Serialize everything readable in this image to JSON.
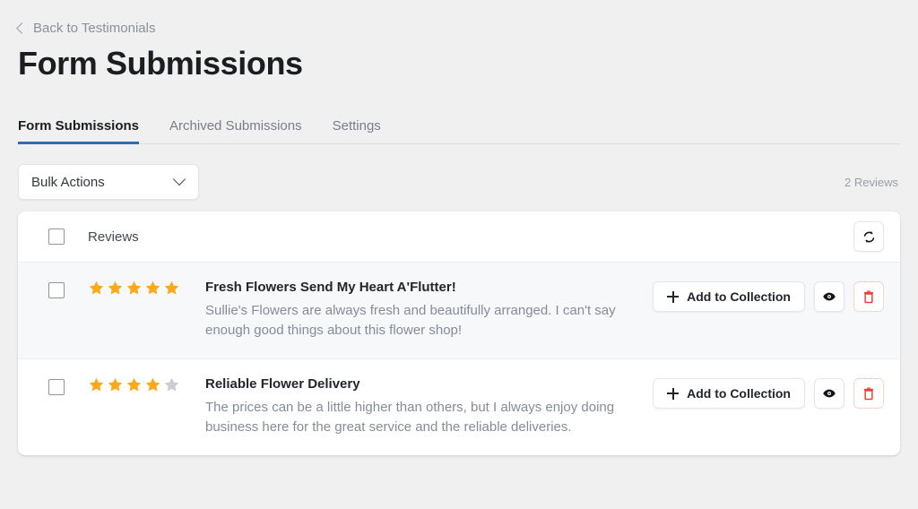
{
  "breadcrumb": {
    "back_label": "Back to Testimonials",
    "chevron_icon": "chevron-left-icon"
  },
  "header": {
    "title": "Form Submissions"
  },
  "tabs": [
    {
      "label": "Form Submissions",
      "active": true
    },
    {
      "label": "Archived Submissions",
      "active": false
    },
    {
      "label": "Settings",
      "active": false
    }
  ],
  "toolbar": {
    "bulk_actions_label": "Bulk Actions",
    "caret_icon": "chevron-down-icon",
    "count_label": "2 Reviews"
  },
  "table": {
    "header": {
      "select_all_checkbox": "unchecked",
      "column_label": "Reviews",
      "refresh_icon": "refresh-sync-icon"
    },
    "actions": {
      "add_label": "Add to Collection",
      "plus_icon": "plus-icon",
      "preview_icon": "eye-icon",
      "delete_icon": "trash-icon"
    },
    "rows": [
      {
        "checked": false,
        "rating": 5,
        "max_rating": 5,
        "title": "Fresh Flowers Send My Heart A'Flutter!",
        "body": "Sullie's Flowers are always fresh and beautifully arranged. I can't say enough good things about this flower shop!"
      },
      {
        "checked": false,
        "rating": 4,
        "max_rating": 5,
        "title": "Reliable Flower Delivery",
        "body": "The prices can be a little higher than others, but I always enjoy doing business here for the great service and the reliable deliveries."
      }
    ]
  },
  "colors": {
    "page_background": "#f0f0f0",
    "accent_tab": "#2c6cb5",
    "star_filled": "#f9a91a",
    "star_empty": "#c9ccd2",
    "delete_red": "#e8413a",
    "row_shaded": "#f7f8fa"
  }
}
